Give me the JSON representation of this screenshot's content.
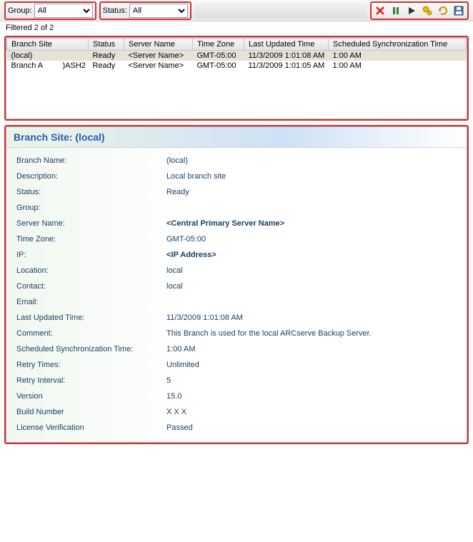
{
  "toolbar": {
    "group_label": "Group:",
    "group_value": "All",
    "status_label": "Status:",
    "status_value": "All"
  },
  "icons": {
    "delete": "✖",
    "pause": "❚❚",
    "play": "▶",
    "sync": "⟲",
    "refresh": "⟳",
    "save": "💾"
  },
  "filtered_caption": "Filtered 2 of 2",
  "grid": {
    "columns": [
      "Branch Site",
      "Status",
      "Server Name",
      "Time Zone",
      "Last Updated Time",
      "Scheduled Synchronization Time"
    ],
    "rows": [
      {
        "branch": "(local)",
        "extra": "",
        "status": "Ready",
        "server": "<Server Name>",
        "tz": "GMT-05:00",
        "updated": "11/3/2009 1:01:08 AM",
        "sched": "1:00 AM",
        "selected": true
      },
      {
        "branch": "Branch A",
        "extra": ")ASH2",
        "status": "Ready",
        "server": "<Server Name>",
        "tz": "GMT-05:00",
        "updated": "11/3/2009 1:01:05 AM",
        "sched": "1:00 AM",
        "selected": false
      }
    ]
  },
  "details": {
    "title": "Branch Site: (local)",
    "rows": [
      {
        "label": "Branch Name:",
        "value": "(local)"
      },
      {
        "label": "Description:",
        "value": "Local branch site"
      },
      {
        "label": "Status:",
        "value": "Ready"
      },
      {
        "label": "Group:",
        "value": ""
      },
      {
        "label": "Server Name:",
        "value": "<Central Primary Server Name>",
        "bold": true
      },
      {
        "label": "Time Zone:",
        "value": "GMT-05:00"
      },
      {
        "label": "IP:",
        "value": "<IP Address>",
        "bold": true
      },
      {
        "label": "Location:",
        "value": "local"
      },
      {
        "label": "Contact:",
        "value": "local"
      },
      {
        "label": "Email:",
        "value": ""
      },
      {
        "label": "Last Updated Time:",
        "value": "11/3/2009 1:01:08 AM"
      },
      {
        "label": "Comment:",
        "value": "This Branch is used for the local  ARCserve Backup Server."
      },
      {
        "label": "Scheduled Synchronization Time:",
        "value": "1:00 AM"
      },
      {
        "label": "Retry Times:",
        "value": "Unlimited"
      },
      {
        "label": "Retry Interval:",
        "value": "5"
      },
      {
        "label": "Version",
        "value": "15.0"
      },
      {
        "label": "Build Number",
        "value": "X X X"
      },
      {
        "label": "License Verification",
        "value": "Passed"
      }
    ]
  }
}
